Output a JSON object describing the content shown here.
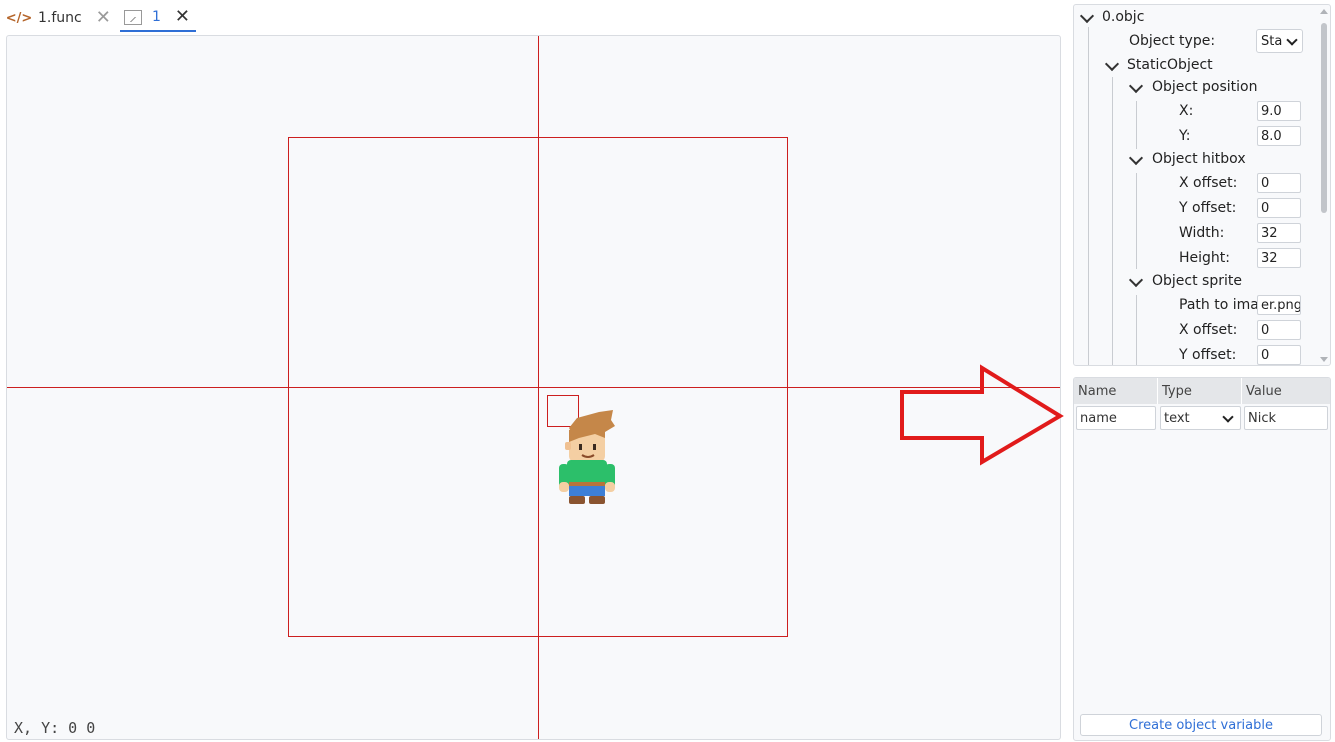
{
  "tabs": [
    {
      "label": "1.func",
      "icon": "code-icon"
    },
    {
      "label": "1",
      "icon": "image-icon",
      "active": true
    }
  ],
  "canvas": {
    "coords_label": "X, Y: 0   0",
    "sprite": "character-sprite"
  },
  "tree": {
    "root": "0.objc",
    "object_type_label": "Object type:",
    "object_type_value": "Sta",
    "static_object": "StaticObject",
    "position": {
      "label": "Object position",
      "x_label": "X:",
      "x": "9.0",
      "y_label": "Y:",
      "y": "8.0"
    },
    "hitbox": {
      "label": "Object hitbox",
      "x_offset_label": "X offset:",
      "x_offset": "0",
      "y_offset_label": "Y offset:",
      "y_offset": "0",
      "width_label": "Width:",
      "width": "32",
      "height_label": "Height:",
      "height": "32"
    },
    "sprite": {
      "label": "Object sprite",
      "path_label": "Path to imag",
      "path": "er.png",
      "x_offset_label": "X offset:",
      "x_offset": "0",
      "y_offset_label": "Y offset:",
      "y_offset": "0"
    }
  },
  "variables": {
    "headers": [
      "Name",
      "Type",
      "Value"
    ],
    "rows": [
      {
        "name": "name",
        "type": "text",
        "value": "Nick"
      }
    ],
    "create_button": "Create object variable"
  },
  "colors": {
    "accent": "#2f6fd6",
    "guide_red": "#cc1f1f",
    "annotation_arrow": "#e11b1b"
  }
}
